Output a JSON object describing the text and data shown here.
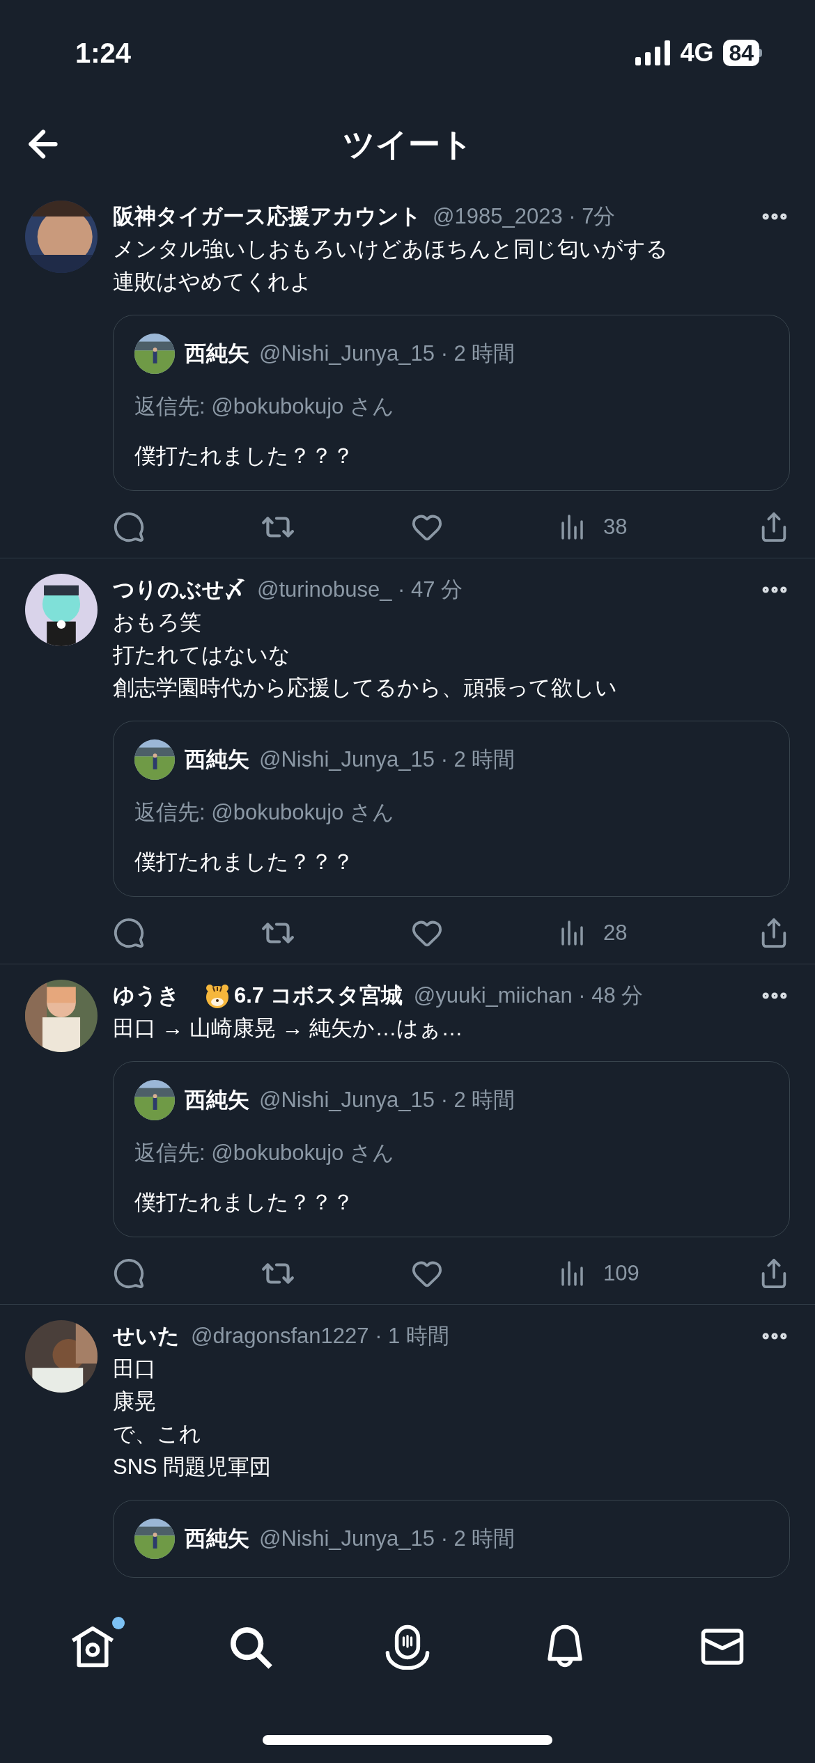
{
  "status_bar": {
    "time": "1:24",
    "network": "4G",
    "battery": "84"
  },
  "header": {
    "title": "ツイート"
  },
  "tweets": [
    {
      "name": "阪神タイガース応援アカウント",
      "meta": "@1985_2023 · 7分",
      "lines": [
        "メンタル強いしおもろいけどあほちんと同じ匂いがする",
        "連敗はやめてくれよ"
      ],
      "quote": {
        "name": "西純矢",
        "meta": "@Nishi_Junya_15 · 2 時間",
        "reply_to": "返信先: @bokubokujo さん",
        "text": "僕打たれました？？？"
      },
      "views": "38"
    },
    {
      "name": "つりのぶせ〆",
      "meta": "@turinobuse_ · 47 分",
      "lines": [
        "おもろ笑",
        "打たれてはないな",
        "創志学園時代から応援してるから、頑張って欲しい"
      ],
      "quote": {
        "name": "西純矢",
        "meta": "@Nishi_Junya_15 · 2 時間",
        "reply_to": "返信先: @bokubokujo さん",
        "text": "僕打たれました？？？"
      },
      "views": "28"
    },
    {
      "name": "ゆうき",
      "tiger_emoji": true,
      "name_suffix": "6.7 コボスタ宮城",
      "meta": "@yuuki_miichan · 48 分",
      "lines": [
        "田口 → 山崎康晃 → 純矢か…はぁ…"
      ],
      "quote": {
        "name": "西純矢",
        "meta": "@Nishi_Junya_15 · 2 時間",
        "reply_to": "返信先: @bokubokujo さん",
        "text": "僕打たれました？？？"
      },
      "views": "109"
    },
    {
      "name": "せいた",
      "meta": "@dragonsfan1227 · 1 時間",
      "lines": [
        "田口",
        "康晃",
        "で、これ",
        "SNS 問題児軍団"
      ],
      "quote": {
        "name": "西純矢",
        "meta": "@Nishi_Junya_15 · 2 時間"
      }
    }
  ],
  "nav": [
    {
      "kind": "home",
      "dot": true
    },
    {
      "kind": "search",
      "dot": false
    },
    {
      "kind": "spaces",
      "dot": false
    },
    {
      "kind": "bell",
      "dot": false
    },
    {
      "kind": "mail",
      "dot": false
    }
  ]
}
